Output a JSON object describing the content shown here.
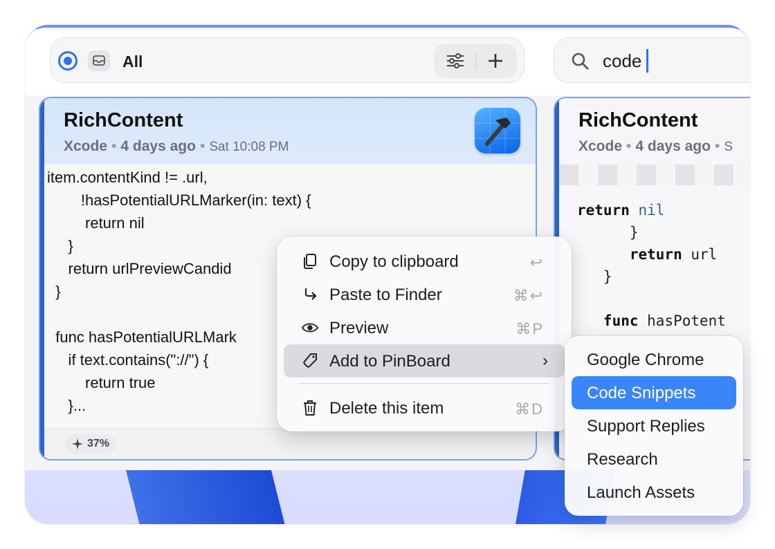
{
  "filter": {
    "label": "All"
  },
  "search": {
    "query": "code"
  },
  "cards": [
    {
      "title": "RichContent",
      "app": "Xcode",
      "age": "4 days ago",
      "time": "Sat 10:08 PM",
      "code_lines": [
        "item.contentKind != .url,",
        "        !hasPotentialURLMarker(in: text) {",
        "         return nil",
        "     }",
        "     return urlPreviewCandid",
        "  }",
        "",
        "  func hasPotentialURLMark",
        "     if text.contains(\"://\") {",
        "         return true",
        "     }..."
      ],
      "badge": "37%"
    },
    {
      "title": "RichContent",
      "app": "Xcode",
      "age": "4 days ago",
      "time": "S"
    }
  ],
  "card2_code": {
    "l1_kw": "return",
    "l1_rest": " nil",
    "l2": "      }",
    "l3_kw": "      return",
    "l3_rest": " url",
    "l4": "   }",
    "l5": "",
    "l6_kw": "   func",
    "l6_rest": " hasPotent"
  },
  "context_menu": [
    {
      "label": "Copy to clipboard",
      "shortcut": "↩",
      "icon": "copy-icon"
    },
    {
      "label": "Paste to Finder",
      "shortcut": "⌘↩",
      "icon": "paste-arrow-icon"
    },
    {
      "label": "Preview",
      "shortcut": "⌘P",
      "icon": "eye-icon"
    },
    {
      "label": "Add to PinBoard",
      "shortcut": "",
      "icon": "tag-icon",
      "submenu": true
    },
    {
      "label": "Delete this item",
      "shortcut": "⌘D",
      "icon": "trash-icon"
    }
  ],
  "submenu": {
    "items": [
      "Google Chrome",
      "Code Snippets",
      "Support Replies",
      "Research",
      "Launch Assets"
    ],
    "selected": "Code Snippets"
  },
  "colors": {
    "accent": "#2f6ff5",
    "selection": "#3a86f8",
    "card_border": "#6ea6e8"
  }
}
